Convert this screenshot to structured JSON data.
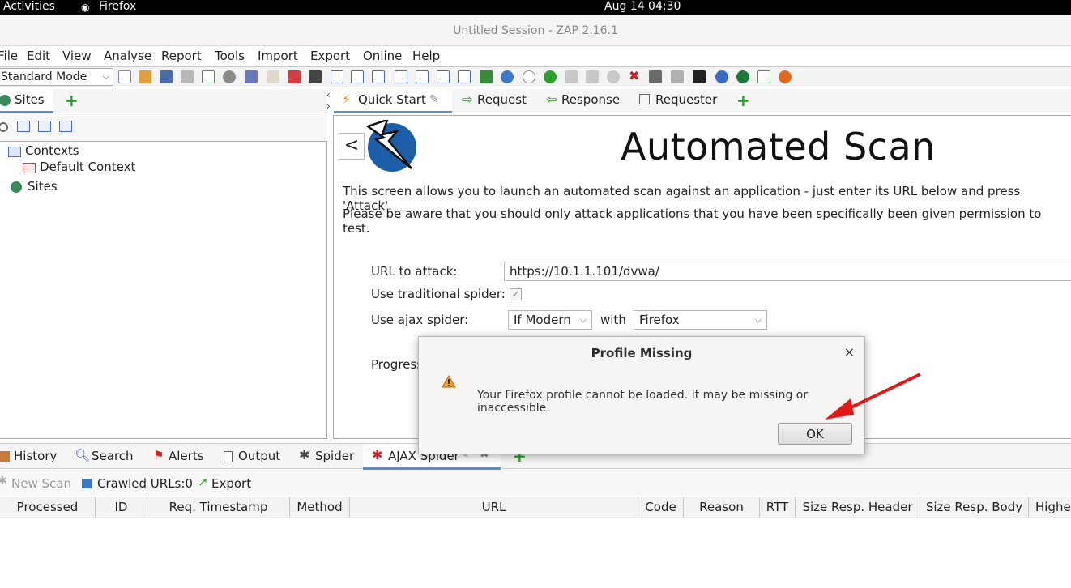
{
  "topbar": {
    "activities": "Activities",
    "app": "Firefox",
    "clock": "Aug 14  04:30"
  },
  "window": {
    "title": "Untitled Session - ZAP 2.16.1"
  },
  "menu": [
    "File",
    "Edit",
    "View",
    "Analyse",
    "Report",
    "Tools",
    "Import",
    "Export",
    "Online",
    "Help"
  ],
  "toolbar": {
    "mode": "Standard Mode"
  },
  "left_panel": {
    "tab": "Sites",
    "tree": {
      "contexts": "Contexts",
      "default_context": "Default Context",
      "sites": "Sites"
    }
  },
  "main_tabs": {
    "quick_start": "Quick Start",
    "request": "Request",
    "response": "Response",
    "requester": "Requester"
  },
  "quick_start": {
    "back": "<",
    "title": "Automated Scan",
    "desc1": "This screen allows you to launch an automated scan against  an application - just enter its URL below and press 'Attack'.",
    "desc2": "Please be aware that you should only attack applications that you have been specifically been given permission to test.",
    "url_label": "URL to attack:",
    "url_value": "https://10.1.1.101/dvwa/",
    "trad_label": "Use traditional spider:",
    "ajax_label": "Use ajax spider:",
    "ajax_mode": "If Modern",
    "with": "with",
    "browser": "Firefox",
    "progress_label": "Progress"
  },
  "dialog": {
    "title": "Profile Missing",
    "close": "×",
    "message": "Your Firefox profile cannot be loaded. It may be missing or inaccessible.",
    "ok": "OK"
  },
  "bottom_tabs": {
    "history": "History",
    "search": "Search",
    "alerts": "Alerts",
    "output": "Output",
    "spider": "Spider",
    "ajax_spider": "AJAX Spider"
  },
  "bottom_toolbar": {
    "new_scan": "New Scan",
    "crawled": "Crawled URLs:0",
    "export": "Export"
  },
  "columns": [
    "Processed",
    "ID",
    "Req. Timestamp",
    "Method",
    "URL",
    "Code",
    "Reason",
    "RTT",
    "Size Resp. Header",
    "Size Resp. Body",
    "Highe"
  ]
}
